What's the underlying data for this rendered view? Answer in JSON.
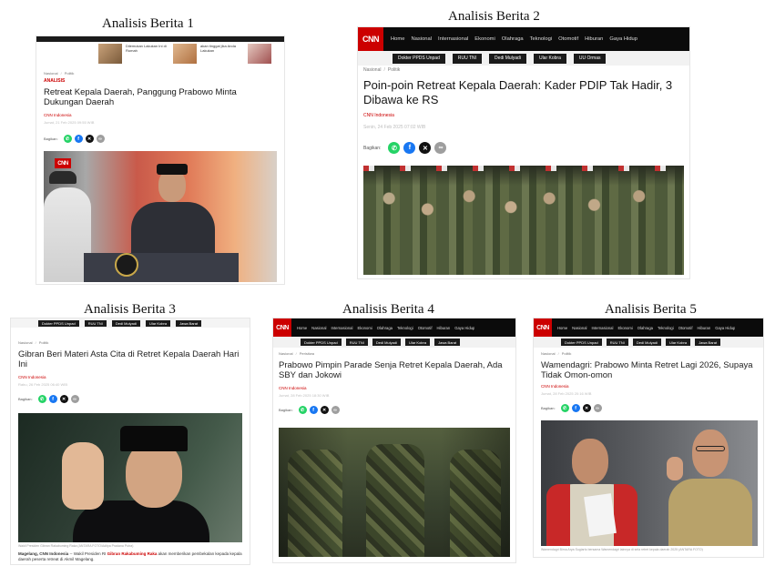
{
  "captions": [
    "Analisis Berita 1",
    "Analisis Berita 2",
    "Analisis Berita 3",
    "Analisis Berita 4",
    "Analisis Berita 5"
  ],
  "nav": {
    "logo": "CNN",
    "links": [
      "Home",
      "Nasional",
      "Internasional",
      "Ekonomi",
      "Olahraga",
      "Teknologi",
      "Otomotif",
      "Hiburan",
      "Gaya Hidup"
    ],
    "tags": [
      "Dokter PPDS Unpad",
      "RUU TNI",
      "Dedi Mulyadi",
      "Ular Kobra",
      "UU Ormas",
      "Jawa Barat"
    ]
  },
  "article1": {
    "thumb_texts": [
      "Dilemukan Lakukan Ini di Rumah",
      "akan tinggal jika Anda Lakukan"
    ],
    "breadcrumb": [
      "Nasional",
      "Politik"
    ],
    "label": "ANALISIS",
    "headline": "Retreat Kepala Daerah, Panggung Prabowo Minta Dukungan Daerah",
    "source": "CNN Indonesia",
    "date": "Jumat, 21 Feb 2025 09:55 WIB",
    "share_label": "Bagikan:",
    "photo_badge": "CNN"
  },
  "article2": {
    "breadcrumb": [
      "Nasional",
      "Politik"
    ],
    "headline": "Poin-poin Retreat Kepala Daerah: Kader PDIP Tak Hadir, 3 Dibawa ke RS",
    "source": "CNN Indonesia",
    "date": "Senin, 24 Feb 2025 07:02 WIB",
    "share_label": "Bagikan:"
  },
  "article3": {
    "breadcrumb": [
      "Nasional",
      "Politik"
    ],
    "headline": "Gibran Beri Materi Asta Cita di Retret Kepala Daerah Hari Ini",
    "source": "CNN Indonesia",
    "date": "Rabu, 26 Feb 2025 06:40 WIB",
    "share_label": "Bagikan:",
    "photo_caption": "Wakil Presiden Gibran Rakabuming Raka (ANTARA FOTO/Aditya Pradana Putra)",
    "body_lead": "Magelang, CNN Indonesia",
    "body_dash": " -- Wakil Presiden RI ",
    "body_name": "Gibran Rakabuming Raka",
    "body_rest": " akan memberikan pembekalan kepada kepala daerah peserta retreat di Akmil Magelang."
  },
  "article4": {
    "breadcrumb": [
      "Nasional",
      "Peristiwa"
    ],
    "headline": "Prabowo Pimpin Parade Senja Retret Kepala Daerah, Ada SBY dan Jokowi",
    "source": "CNN Indonesia",
    "date": "Jumat, 28 Feb 2025 18:30 WIB",
    "share_label": "Bagikan:"
  },
  "article5": {
    "breadcrumb": [
      "Nasional",
      "Politik"
    ],
    "headline": "Wamendagri: Prabowo Minta Retret Lagi 2026, Supaya Tidak Omon-omon",
    "source": "CNN Indonesia",
    "date": "Jumat, 28 Feb 2025 20:16 WIB",
    "share_label": "Bagikan:",
    "photo_caption": "Wamendagri Bima Arya Sugiarto bersama Wamendagri lainnya di sela retret kepala daerah 2025 (ANTARA FOTO)"
  },
  "colors": {
    "cnn_red": "#cc0000",
    "nav_black": "#0b0b0b",
    "whatsapp": "#25d366",
    "facebook": "#1877f2",
    "x": "#111111",
    "link": "#9e9e9e"
  },
  "icons": [
    "whatsapp-icon",
    "facebook-icon",
    "x-icon",
    "link-icon",
    "garuda-emblem-icon"
  ]
}
